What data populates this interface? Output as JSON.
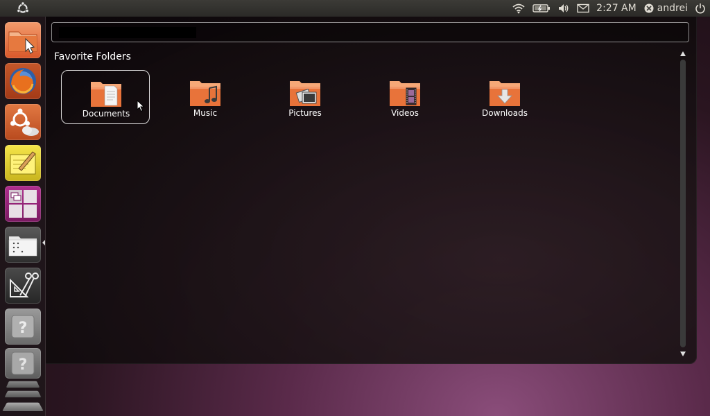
{
  "top_panel": {
    "clock": "2:27 AM",
    "user_name": "andrei",
    "indicators": [
      "wifi-icon",
      "battery-icon",
      "volume-icon",
      "mail-icon",
      "user-status-icon",
      "power-icon"
    ]
  },
  "launcher": {
    "items": [
      {
        "name": "home-folder",
        "icon": "folder-cursor-icon"
      },
      {
        "name": "firefox",
        "icon": "firefox-icon"
      },
      {
        "name": "ubuntu-one",
        "icon": "ubuntu-one-icon"
      },
      {
        "name": "text-editor",
        "icon": "notepad-icon"
      },
      {
        "name": "workspace-switcher",
        "icon": "workspaces-icon"
      },
      {
        "name": "files-folders",
        "icon": "files-lens-icon"
      },
      {
        "name": "applications",
        "icon": "applications-lens-icon"
      },
      {
        "name": "unknown-app-1",
        "icon": "question-icon"
      },
      {
        "name": "unknown-app-2",
        "icon": "question-icon"
      }
    ]
  },
  "dash": {
    "search": {
      "value": "",
      "placeholder": ""
    },
    "section_title": "Favorite Folders",
    "folders": [
      {
        "label": "Documents",
        "icon": "documents-folder-icon",
        "selected": true
      },
      {
        "label": "Music",
        "icon": "music-folder-icon",
        "selected": false
      },
      {
        "label": "Pictures",
        "icon": "pictures-folder-icon",
        "selected": false
      },
      {
        "label": "Videos",
        "icon": "videos-folder-icon",
        "selected": false
      },
      {
        "label": "Downloads",
        "icon": "downloads-folder-icon",
        "selected": false
      }
    ]
  },
  "colors": {
    "folder_orange": "#e8733a",
    "panel_bg": "#3c3b37",
    "accent": "#dd4814"
  }
}
